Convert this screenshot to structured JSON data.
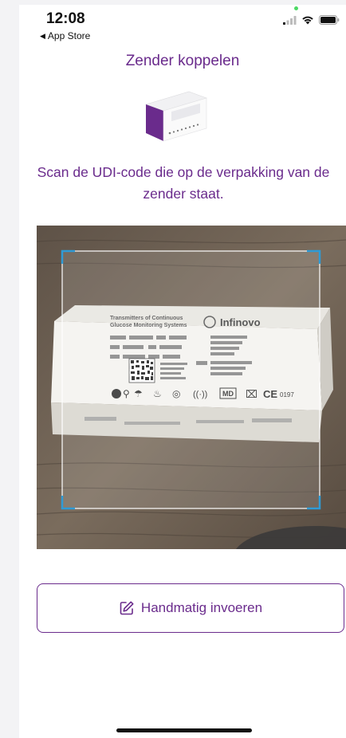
{
  "status_bar": {
    "time": "12:08",
    "back_label": "App Store",
    "icons": [
      "cellular-signal-icon",
      "wifi-icon",
      "battery-icon"
    ]
  },
  "page": {
    "title": "Zender koppelen",
    "instruction": "Scan de UDI-code die op de verpakking van de zender staat."
  },
  "scanned_package": {
    "heading_line1": "Transmitters of Continuous",
    "heading_line2": "Glucose Monitoring Systems",
    "brand": "Infinovo",
    "ce_mark": "CE",
    "ce_number": "0197",
    "md_label": "MD"
  },
  "manual_entry": {
    "label": "Handmatig invoeren",
    "icon": "edit-icon"
  },
  "colors": {
    "accent": "#6a2b8c",
    "scanner_corner": "#2f9bd6"
  }
}
